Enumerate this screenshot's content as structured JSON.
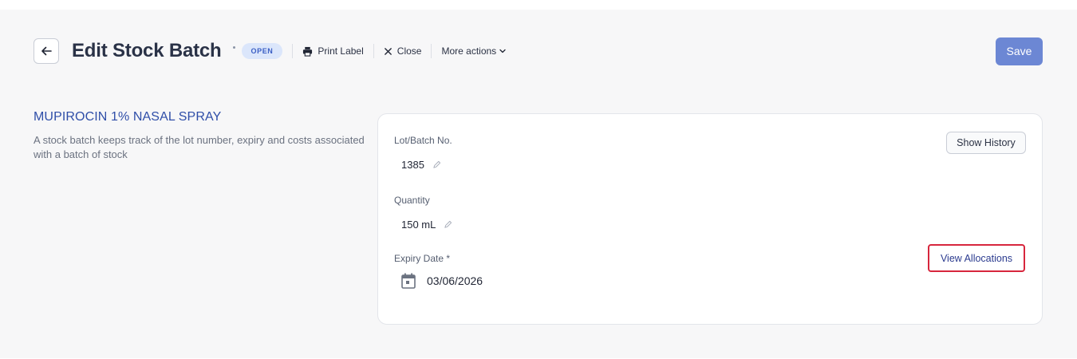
{
  "header": {
    "title": "Edit Stock Batch",
    "status_badge": "OPEN",
    "actions": {
      "print_label": "Print Label",
      "close": "Close",
      "more_actions": "More actions"
    },
    "save_label": "Save"
  },
  "description": {
    "title": "MUPIROCIN 1% NASAL SPRAY",
    "text": "A stock batch keeps track of the lot number, expiry and costs associated with a batch of stock"
  },
  "form": {
    "lot_batch": {
      "label": "Lot/Batch No.",
      "value": "1385"
    },
    "quantity": {
      "label": "Quantity",
      "value": "150 mL"
    },
    "expiry": {
      "label": "Expiry Date *",
      "value": "03/06/2026"
    },
    "show_history_label": "Show History",
    "view_allocations_label": "View Allocations"
  },
  "icons": {
    "back": "arrow-left-icon",
    "print": "printer-icon",
    "close": "x-icon",
    "caret": "chevron-down-icon",
    "edit": "pencil-icon",
    "calendar": "calendar-icon"
  },
  "colors": {
    "accent": "#6c87d4",
    "title_blue": "#2f4ea8",
    "badge_bg": "#dbe6fb",
    "badge_text": "#3b5fc4",
    "highlight_border": "#d7263d"
  }
}
